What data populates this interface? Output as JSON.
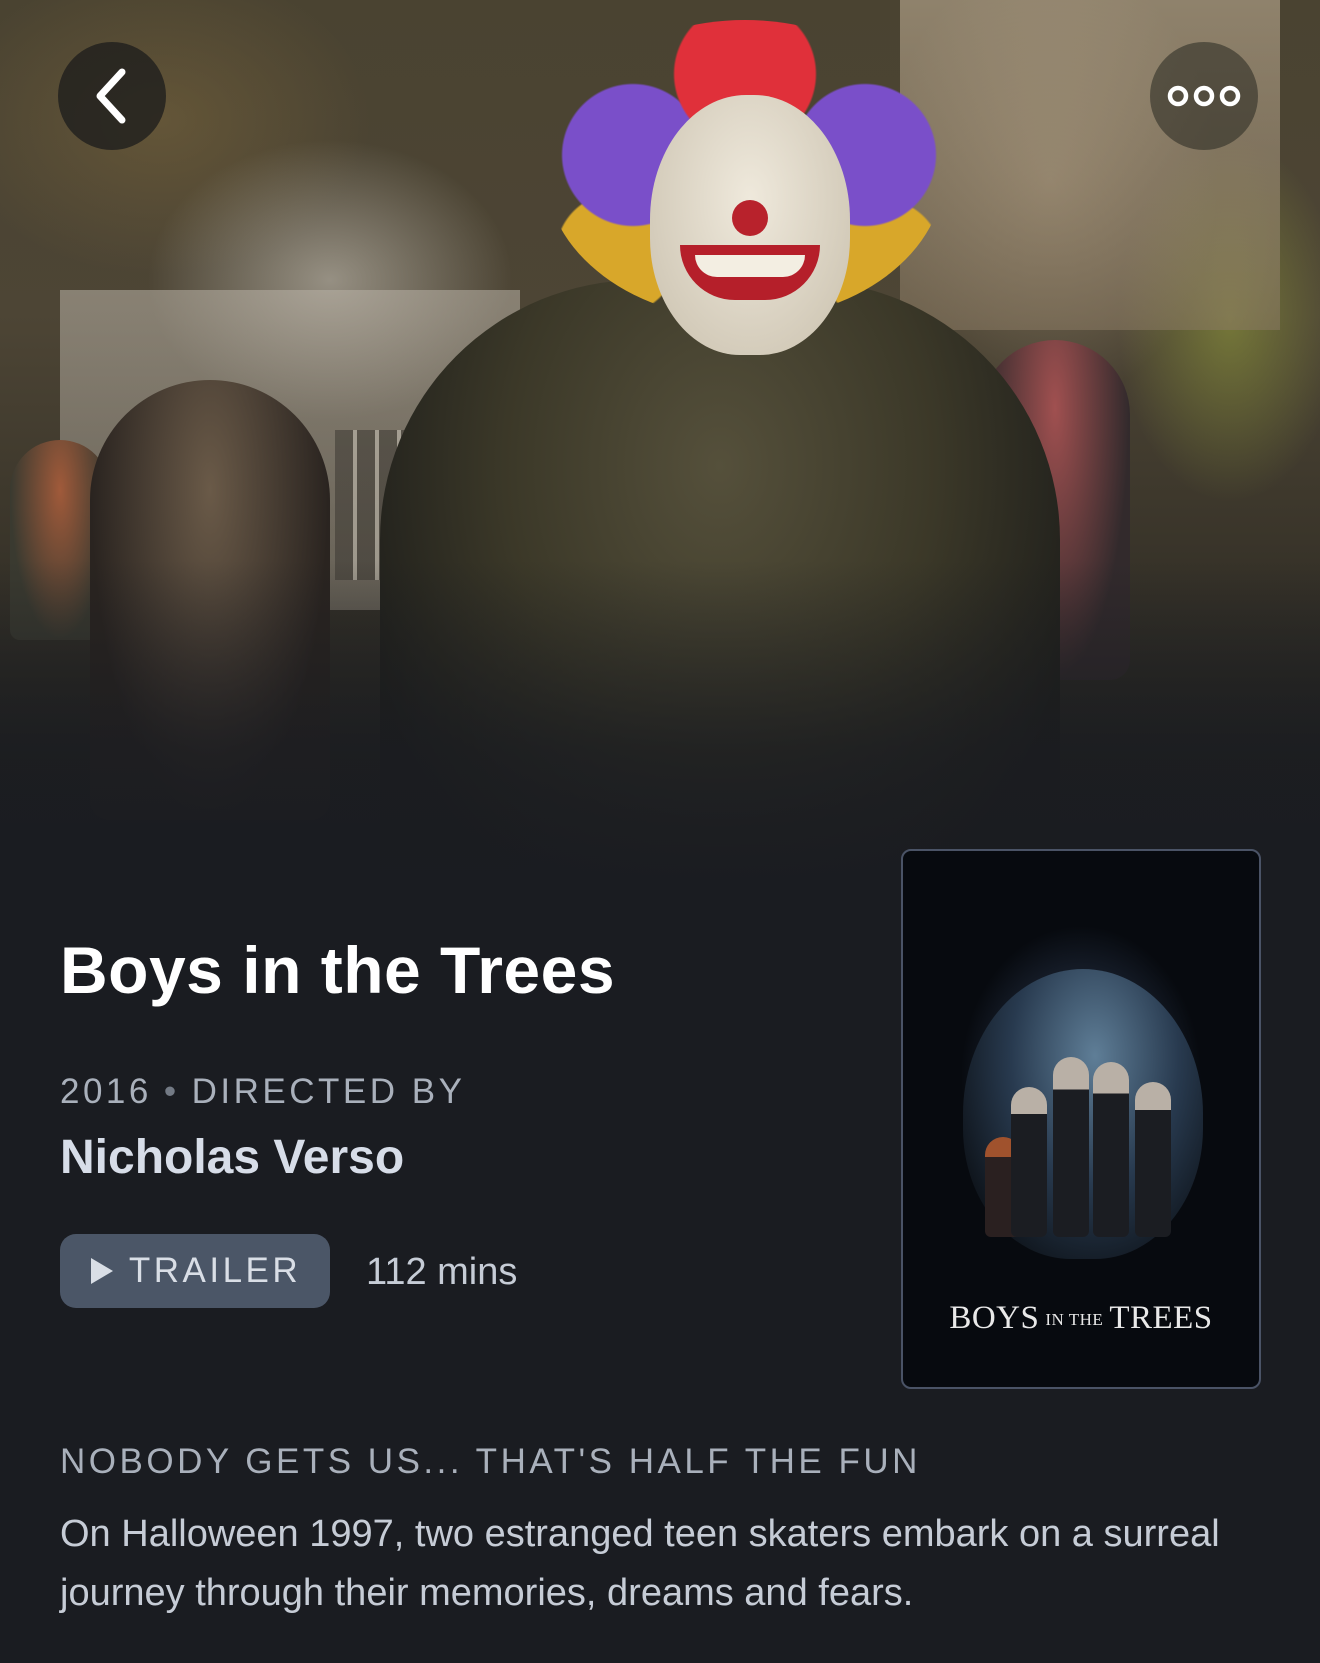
{
  "film": {
    "title": "Boys in the Trees",
    "year": "2016",
    "directed_by_label": "DIRECTED BY",
    "separator": "•",
    "director": "Nicholas Verso",
    "runtime": "112 mins",
    "tagline": "NOBODY GETS US... THAT'S HALF THE FUN",
    "synopsis": "On Halloween 1997, two estranged teen skaters embark on a surreal journey through their memories, dreams and fears."
  },
  "actions": {
    "trailer_label": "TRAILER",
    "back_icon": "chevron-left-icon",
    "more_icon": "more-options-icon",
    "play_icon": "play-icon"
  },
  "poster": {
    "title_part1": "BOYS",
    "title_part2": "IN THE",
    "title_part3": "TREES"
  },
  "colors": {
    "background": "#1a1c21",
    "trailer_button": "#4b5667",
    "poster_border": "#4a5366",
    "muted_text": "#a9b0bb",
    "director_text": "#d7dde8"
  }
}
